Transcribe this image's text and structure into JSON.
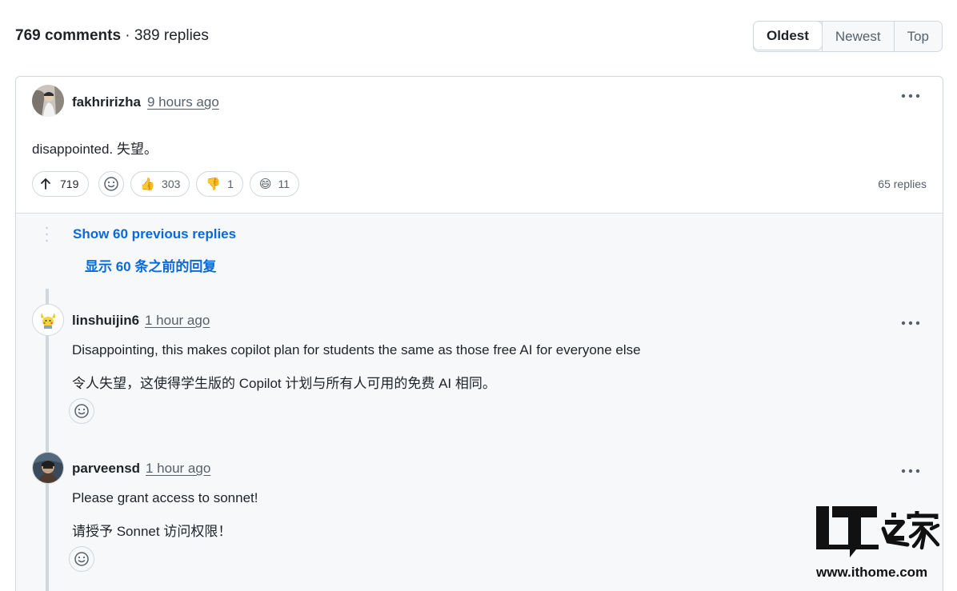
{
  "header": {
    "comments_count": "769 comments",
    "separator": " · ",
    "replies_count": "389 replies",
    "sort_options": [
      "Oldest",
      "Newest",
      "Top"
    ],
    "active_sort": "Oldest"
  },
  "top_comment": {
    "author": "fakhririzha",
    "time": "9 hours ago",
    "body": "disappointed.  失望。",
    "upvotes": "719",
    "reactions": [
      {
        "emoji": "👍",
        "count": "303"
      },
      {
        "emoji": "👎",
        "count": "1"
      },
      {
        "emoji": "😄",
        "count": "11"
      }
    ],
    "replies_label": "65 replies"
  },
  "thread": {
    "show_previous": "Show 60 previous replies",
    "show_previous_cn": "显示 60 条之前的回复"
  },
  "replies": [
    {
      "author": "linshuijin6",
      "time": "1 hour ago",
      "line_en": "Disappointing, this makes copilot plan for students the same as those free AI for everyone else",
      "line_cn": "令人失望，这使得学生版的 Copilot 计划与所有人可用的免费 AI 相同。"
    },
    {
      "author": "parveensd",
      "time": "1 hour ago",
      "line_en": "Please grant access to sonnet!",
      "line_cn": "请授予 Sonnet 访问权限！"
    }
  ],
  "watermark": {
    "logo_text": "IT之家",
    "url": "www.ithome.com"
  },
  "colors": {
    "link": "#0969da",
    "muted": "#57606a",
    "border": "#d0d7de",
    "thread_bg": "#f6f8fa"
  }
}
